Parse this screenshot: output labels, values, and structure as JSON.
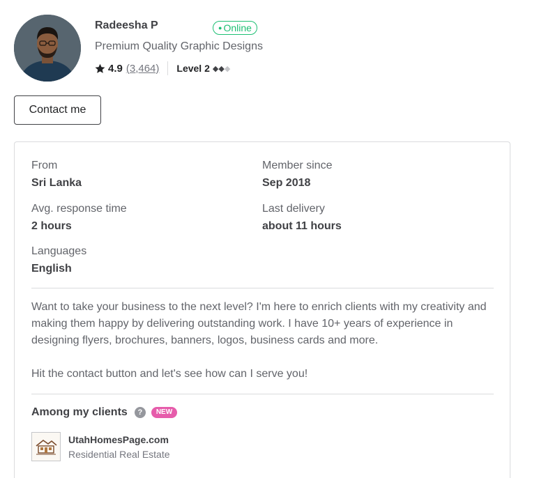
{
  "seller": {
    "name": "Radeesha P",
    "status": "Online",
    "tagline": "Premium Quality Graphic Designs",
    "rating": "4.9",
    "reviews": "(3,464)",
    "level": "Level 2",
    "level_diamonds_filled": 2,
    "level_diamonds_total": 3
  },
  "actions": {
    "contact_label": "Contact me"
  },
  "stats": {
    "from_label": "From",
    "from_value": "Sri Lanka",
    "member_label": "Member since",
    "member_value": "Sep 2018",
    "response_label": "Avg. response time",
    "response_value": "2 hours",
    "delivery_label": "Last delivery",
    "delivery_value": "about 11 hours",
    "languages_label": "Languages",
    "languages_value": "English"
  },
  "description": {
    "p1": "Want to take your business to the next level? I'm here to enrich clients with my creativity and making them happy by delivering outstanding work. I have 10+ years of experience in designing flyers, brochures, banners, logos, business cards and more.",
    "p2": "Hit the contact button and let's see how can I serve you!"
  },
  "clients": {
    "title": "Among my clients",
    "help_icon": "?",
    "new_badge": "NEW",
    "items": [
      {
        "name": "UtahHomesPage.com",
        "type": "Residential Real Estate"
      }
    ]
  },
  "colors": {
    "online": "#1dbf73",
    "new_badge": "#e65cab",
    "text_dark": "#404145",
    "text_muted": "#62646a"
  }
}
